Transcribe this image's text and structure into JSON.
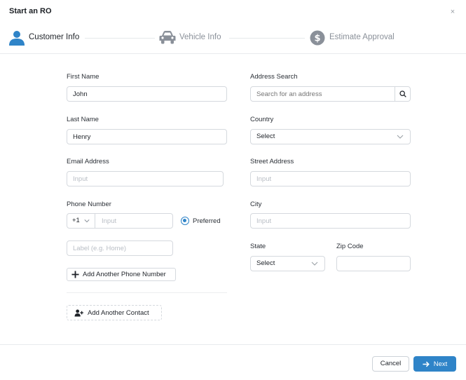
{
  "modal": {
    "title": "Start an RO",
    "close_glyph": "×"
  },
  "steps": [
    {
      "label": "Customer Info",
      "icon": "person-icon",
      "active": true
    },
    {
      "label": "Vehicle Info",
      "icon": "car-icon",
      "active": false
    },
    {
      "label": "Estimate Approval",
      "icon": "dollar-icon",
      "active": false
    }
  ],
  "colors": {
    "accent": "#2f84c8",
    "inactive": "#8a9099",
    "border": "#d5d9de"
  },
  "form": {
    "first_name": {
      "label": "First Name",
      "value": "John"
    },
    "last_name": {
      "label": "Last Name",
      "value": "Henry"
    },
    "email": {
      "label": "Email Address",
      "placeholder": "Input"
    },
    "phone": {
      "label": "Phone Number",
      "country_code": "+1",
      "placeholder": "Input",
      "preferred_label": "Preferred",
      "label_placeholder": "Label (e.g. Home)"
    },
    "add_phone_label": "Add Another Phone Number",
    "add_contact_label": "Add Another Contact",
    "address_search": {
      "label": "Address Search",
      "placeholder": "Search for an address"
    },
    "country": {
      "label": "Country",
      "value": "Select"
    },
    "street": {
      "label": "Street Address",
      "placeholder": "Input"
    },
    "city": {
      "label": "City",
      "placeholder": "Input"
    },
    "state": {
      "label": "State",
      "value": "Select"
    },
    "zip": {
      "label": "Zip Code",
      "value": ""
    }
  },
  "footer": {
    "cancel_label": "Cancel",
    "next_label": "Next"
  }
}
